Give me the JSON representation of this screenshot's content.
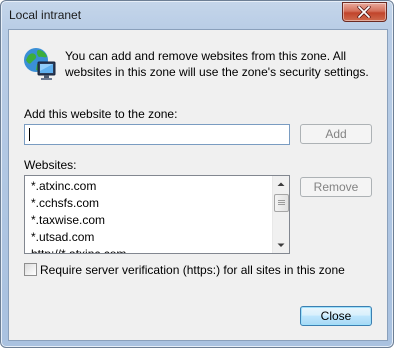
{
  "window": {
    "title": "Local intranet"
  },
  "intro_text": "You can add and remove websites from this zone. All websites in this zone will use the zone's security settings.",
  "add_label": "Add this website to the zone:",
  "add_input_value": "",
  "add_button": "Add",
  "websites_label": "Websites:",
  "websites": [
    "*.atxinc.com",
    "*.cchsfs.com",
    "*.taxwise.com",
    "*.utsad.com",
    "http://*.atxinc.com"
  ],
  "remove_button": "Remove",
  "require_https_label": "Require server verification (https:) for all sites in this zone",
  "require_https_checked": false,
  "close_button": "Close"
}
